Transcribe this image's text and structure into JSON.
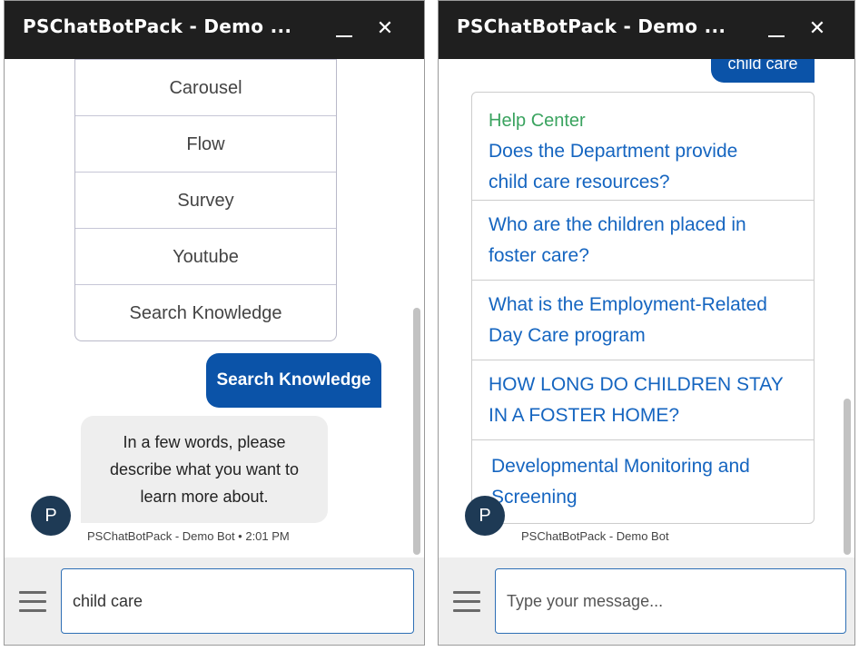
{
  "left_panel": {
    "header": {
      "title": "PSChatBotPack - Demo ...",
      "minimize_glyph": "_",
      "close_glyph": "✕"
    },
    "options": [
      "Carousel",
      "Flow",
      "Survey",
      "Youtube",
      "Search Knowledge"
    ],
    "user_message": "Search Knowledge",
    "bot_message": {
      "lines": [
        "In a few words, please",
        "describe what you want to",
        "learn more about."
      ]
    },
    "avatar_letter": "P",
    "bot_meta": "PSChatBotPack - Demo Bot • 2:01 PM",
    "input_value": "child care",
    "icons": {
      "menu": "hamburger-menu-icon"
    }
  },
  "right_panel": {
    "header": {
      "title": "PSChatBotPack - Demo ...",
      "minimize_glyph": "_",
      "close_glyph": "✕"
    },
    "user_message_partial": "child care",
    "knowledge": {
      "source_label": "Help Center",
      "articles": [
        {
          "lines": [
            "Does the Department provide",
            "child care resources?"
          ]
        },
        {
          "lines": [
            "Who are the children placed in",
            "foster care?"
          ]
        },
        {
          "lines": [
            "What is the Employment-Related",
            "Day Care program"
          ]
        },
        {
          "lines": [
            "HOW LONG DO CHILDREN STAY",
            "IN A FOSTER HOME?"
          ]
        },
        {
          "lines": [
            "Developmental Monitoring and",
            "Screening"
          ]
        }
      ]
    },
    "avatar_letter": "P",
    "bot_meta": "PSChatBotPack - Demo Bot",
    "input_placeholder": "Type your message...",
    "icons": {
      "menu": "hamburger-menu-icon"
    }
  },
  "colors": {
    "header_bg": "#1f1f1f",
    "user_bubble": "#0b53a8",
    "link": "#1565c0",
    "source_label": "#3aa35f",
    "avatar": "#1e3a55"
  }
}
